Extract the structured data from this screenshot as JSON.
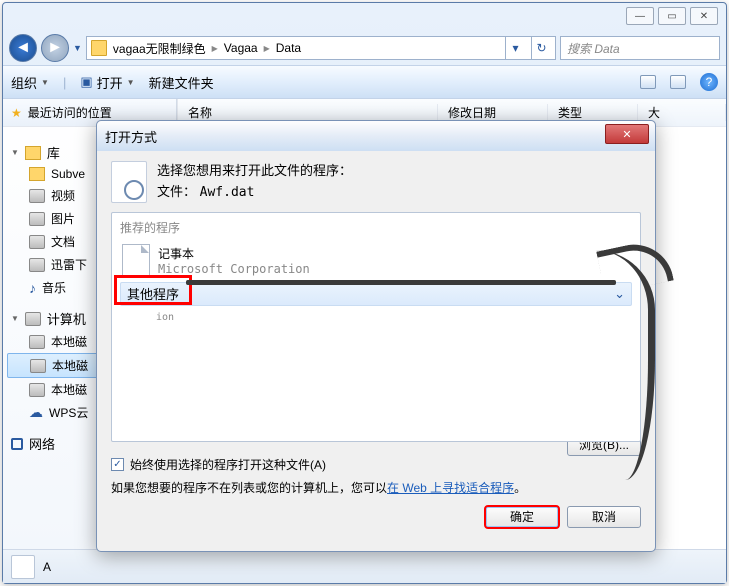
{
  "window_controls": {
    "min": "—",
    "max": "▭",
    "close": "✕"
  },
  "breadcrumb": {
    "p0": "vagaa无限制绿色",
    "p1": "Vagaa",
    "p2": "Data"
  },
  "search": {
    "placeholder": "搜索 Data"
  },
  "toolbar": {
    "organize": "组织",
    "open": "打开",
    "newfolder": "新建文件夹"
  },
  "sidebar": {
    "fav_head": "最近访问的位置",
    "lib_head": "库",
    "items_lib": [
      "Subve",
      "视频",
      "图片",
      "文档",
      "迅雷下",
      "音乐"
    ],
    "comp_head": "计算机",
    "items_comp": [
      "本地磁",
      "本地磁",
      "本地磁",
      "WPS云"
    ],
    "net_head": "网络"
  },
  "columns": {
    "name": "名称",
    "date": "修改日期",
    "type": "类型",
    "size": "大"
  },
  "status": {
    "label": "A"
  },
  "dialog": {
    "title": "打开方式",
    "heading": "选择您想用来打开此文件的程序：",
    "file_label": "文件：",
    "file_name": "Awf.dat",
    "recommended": "推荐的程序",
    "prog_name": "记事本",
    "prog_pub": "Microsoft Corporation",
    "other": "其他程序",
    "sub": "ion",
    "always": "始终使用选择的程序打开这种文件(A)",
    "hint_pre": "如果您想要的程序不在列表或您的计算机上，您可以",
    "hint_link": "在 Web 上寻找适合程序",
    "hint_post": "。",
    "browse": "浏览(B)...",
    "ok": "确定",
    "cancel": "取消"
  }
}
